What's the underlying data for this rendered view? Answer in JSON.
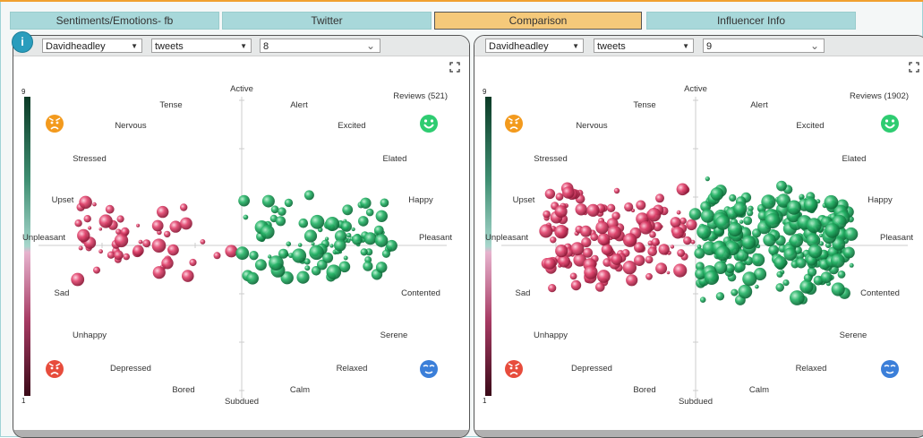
{
  "tabs": [
    {
      "label": "Sentiments/Emotions- fb",
      "active": false
    },
    {
      "label": "Twitter",
      "active": false
    },
    {
      "label": "Comparison",
      "active": true
    },
    {
      "label": "Influencer Info",
      "active": false
    }
  ],
  "info_label": "i",
  "panels": [
    {
      "user_select": "Davidheadley",
      "source_select": "tweets",
      "level_select": "8",
      "reviews": "Reviews (521)"
    },
    {
      "user_select": "Davidheadley",
      "source_select": "tweets",
      "level_select": "9",
      "reviews": "Reviews (1902)"
    }
  ],
  "scale": {
    "max": "9",
    "min": "1"
  },
  "axis_labels": {
    "active": "Active",
    "subdued": "Subdued",
    "unpleasant": "Unpleasant",
    "pleasant": "Pleasant"
  },
  "emotion_labels": {
    "tense": "Tense",
    "alert": "Alert",
    "nervous": "Nervous",
    "excited": "Excited",
    "stressed": "Stressed",
    "elated": "Elated",
    "upset": "Upset",
    "happy": "Happy",
    "sad": "Sad",
    "contented": "Contented",
    "unhappy": "Unhappy",
    "serene": "Serene",
    "depressed": "Depressed",
    "relaxed": "Relaxed",
    "bored": "Bored",
    "calm": "Calm"
  },
  "icons": [
    "angry-orange-face-icon",
    "happy-green-face-icon",
    "angry-red-face-icon",
    "relaxed-blue-face-icon",
    "expand-icon"
  ],
  "colors": {
    "positive": "#1a9e55",
    "negative": "#d2335a",
    "active_tab": "#f5c97a",
    "tab": "#a8d8da",
    "info": "#2a9dbd"
  }
}
